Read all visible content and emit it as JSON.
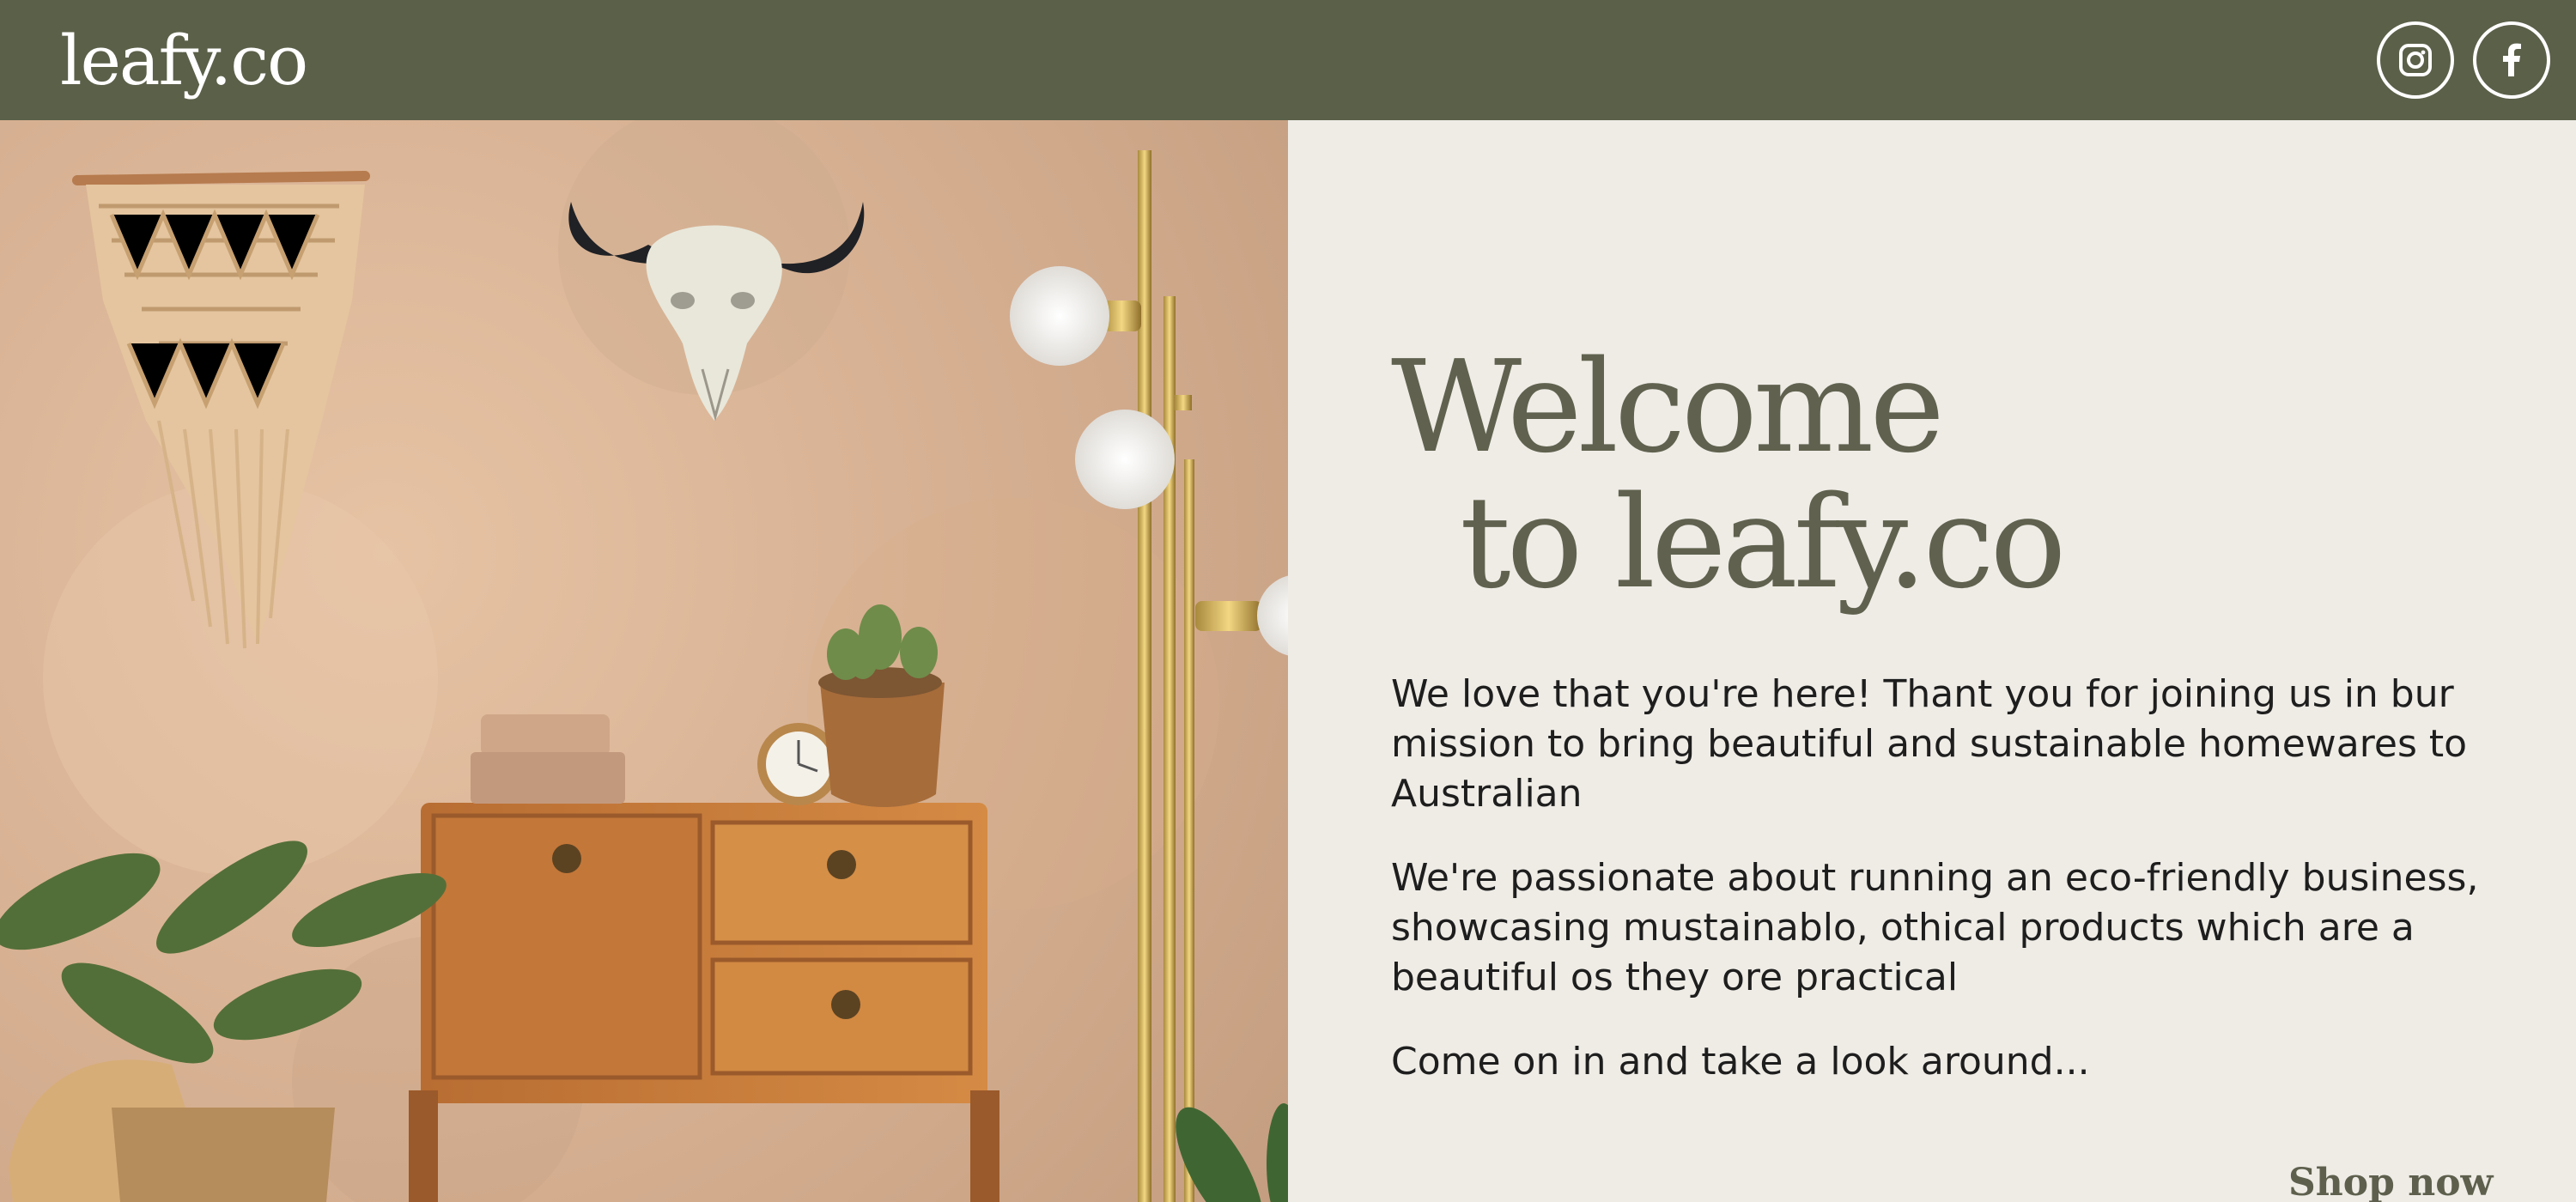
{
  "brand": {
    "name": "leafy.co"
  },
  "header": {
    "socials": [
      {
        "name": "Instagram",
        "icon": "instagram-icon"
      },
      {
        "name": "Facebook",
        "icon": "facebook-icon"
      }
    ]
  },
  "hero": {
    "headline_line1": "Welcome",
    "headline_line2": "to leafy.co",
    "paragraphs": [
      "We love that you're here! Thant you for joining us in bur mission to bring beautiful and sustainable homewares to Australian",
      "We're passionate about running an eco-friendly business, showcasing mustainablo, othical products which are a beautiful os they ore practical",
      "Come on in and take a look around..."
    ],
    "cta": "Shop now"
  },
  "colors": {
    "header": "#5b6049",
    "content_background": "#efece6",
    "headline": "#60624f",
    "body_text": "#1e1e1e"
  }
}
